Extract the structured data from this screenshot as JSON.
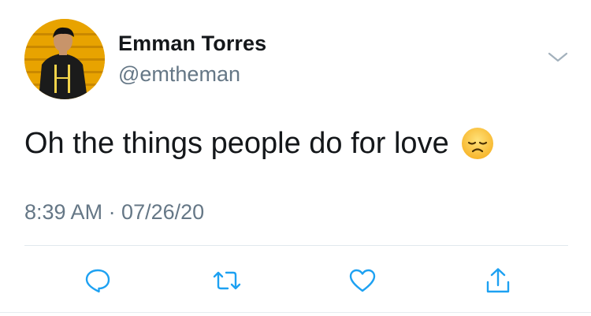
{
  "user": {
    "display_name": "Emman Torres",
    "handle": "@emtheman",
    "avatar_icon": "profile-photo"
  },
  "tweet": {
    "text": "Oh the things people do for love",
    "emoji": "disappointed-face-emoji",
    "timestamp": "8:39 AM · 07/26/20"
  },
  "actions": [
    "reply-icon",
    "retweet-icon",
    "like-icon",
    "share-icon"
  ],
  "colors": {
    "text": "#14171a",
    "secondary": "#657786",
    "icon": "#1da1f2",
    "divider": "#e1e8ed"
  }
}
